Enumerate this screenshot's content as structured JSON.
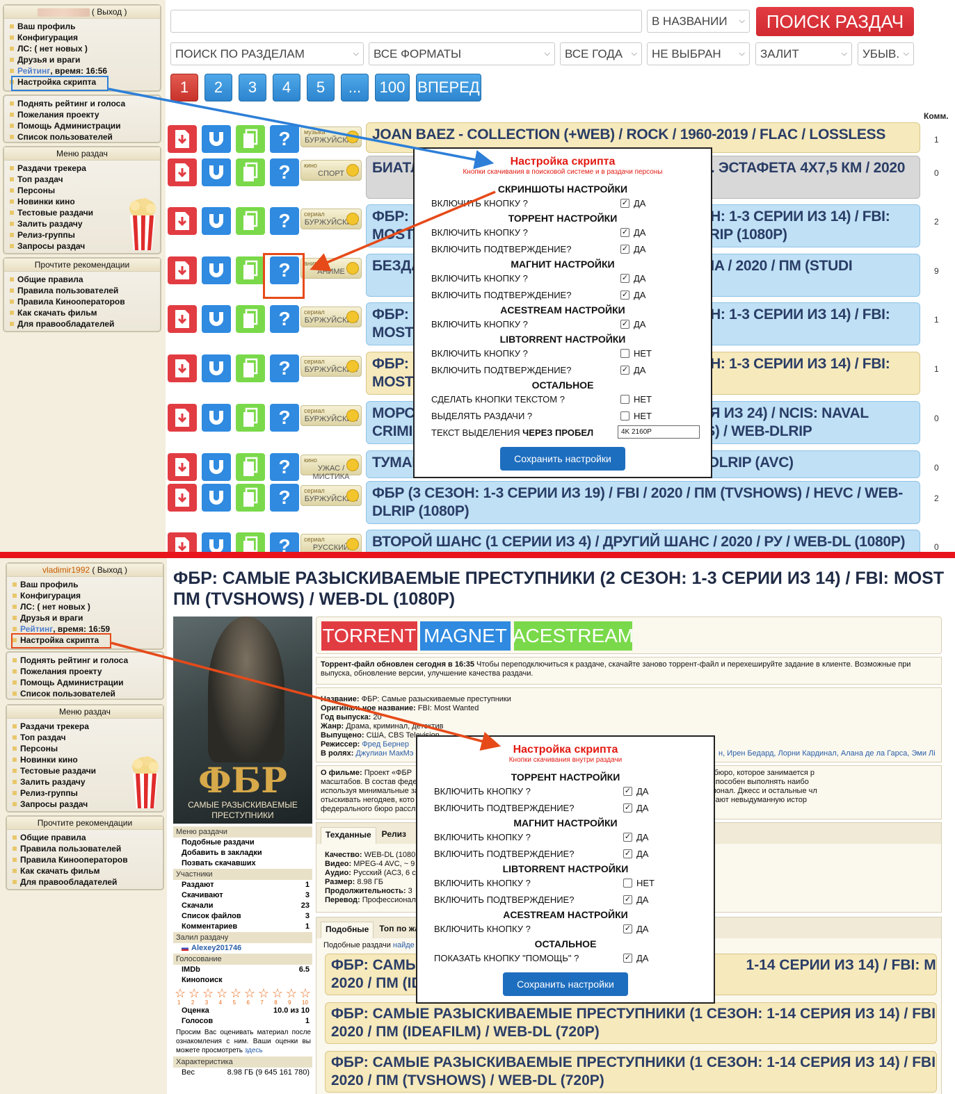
{
  "top": {
    "sidebar_user": {
      "logout": "( Выход )",
      "items": [
        "Ваш профиль",
        "Конфигурация",
        "ЛС: ( нет новых )",
        "Друзья и враги"
      ],
      "rating_link": "Рейтинг",
      "rating_time": ", время: 16:56",
      "script_settings": "Настройка скрипта"
    },
    "sidebar_links": [
      "Поднять рейтинг и голоса",
      "Пожелания проекту",
      "Помощь Администрации",
      "Список пользователей"
    ],
    "menu_header": "Меню раздач",
    "menu_items": [
      "Раздачи трекера",
      "Топ раздач",
      "Персоны",
      "Новинки кино",
      "Тестовые раздачи",
      "Залить раздачу",
      "Релиз-группы",
      "Запросы раздач"
    ],
    "rec_header": "Прочтите рекомендации",
    "rec_items": [
      "Общие правила",
      "Правила пользователей",
      "Правила Кинооператоров",
      "Как скачать фильм",
      "Для правообладателей"
    ],
    "search": {
      "value": "",
      "placeholder": "",
      "scope": "В НАЗВАНИИ",
      "button": "ПОИСК РАЗДАЧ"
    },
    "filters": [
      "ПОИСК ПО РАЗДЕЛАМ",
      "ВСЕ ФОРМАТЫ",
      "ВСЕ ГОДА",
      "НЕ ВЫБРАН",
      "ЗАЛИТ",
      "УБЫВ."
    ],
    "pages": [
      "1",
      "2",
      "3",
      "4",
      "5",
      "...",
      "100",
      "ВПЕРЕД"
    ],
    "comm_header": "Комм.",
    "rows": [
      {
        "cat1": "музыка",
        "cat2": "БУРЖУЙСКАЯ",
        "title": "JOAN BAEZ - COLLECTION (+WEB) / ROCK / 1960-2019 / FLAC / LOSSLESS",
        "color": "y",
        "comm": "1"
      },
      {
        "cat1": "кино",
        "cat2": "СПОРТ",
        "title": "БИАТЛ                                                                     НЫ. ЭСТАФЕТА 4Х7,5 КМ / 2020",
        "color": "g",
        "comm": "0"
      },
      {
        "cat1": "сериал",
        "cat2": "БУРЖУЙСКИЙ",
        "title": "ФБР: С                                                                   ЕЗОН: 1-3 СЕРИИ ИЗ 14) / FBI: MOST                                                                    B-DLRIP (1080P)",
        "color": "b",
        "comm": "2"
      },
      {
        "cat1": "аниме",
        "cat2": "АНИМЕ",
        "title": "БЕЗДА                                                                    NANA / 2020 / ПМ (STUDI",
        "color": "b",
        "comm": "9"
      },
      {
        "cat1": "сериал",
        "cat2": "БУРЖУЙСКИЙ",
        "title": "ФБР: С                                                                   ЕЗОН: 1-3 СЕРИИ ИЗ 14) / FBI: MOST                                                                    0P)",
        "color": "b",
        "comm": "1"
      },
      {
        "cat1": "сериал",
        "cat2": "БУРЖУЙСКИЙ",
        "title": "ФБР: С                                                                   ЕЗОН: 1-3 СЕРИИ ИЗ 14) / FBI: MOST                                                                    80P)",
        "color": "y",
        "comm": "1"
      },
      {
        "cat1": "сериал",
        "cat2": "БУРЖУЙСКИЙ",
        "title": "МОРС                                                                     ЕРИЯ ИЗ 24) / NCIS: NAVAL CRIMIN                                                                   OWS) / WEB-DLRIP",
        "color": "b",
        "comm": "0"
      },
      {
        "cat1": "кино",
        "cat2": "УЖАС / МИСТИКА",
        "title": "ТУМАН                                                                    EB-DLRIP (AVC)",
        "color": "b",
        "comm": "0"
      },
      {
        "cat1": "сериал",
        "cat2": "БУРЖУЙСКИЙ",
        "title": "ФБР (3 СЕЗОН: 1-3 СЕРИИ ИЗ 19) / FBI / 2020 / ПМ (TVSHOWS) / HEVC / WEB-DLRIP (1080P)",
        "color": "b",
        "comm": "2"
      },
      {
        "cat1": "сериал",
        "cat2": "РУССКИЙ",
        "title": "ВТОРОЙ ШАНС (1 СЕРИИ ИЗ 4) / ДРУГИЙ ШАНС / 2020 / РУ / WEB-DL (1080P)",
        "color": "b",
        "comm": "0"
      }
    ],
    "modal": {
      "title": "Настройка скрипта",
      "subtitle": "Кнопки скачивания в поисковой системе и в раздачи персоны",
      "sections": [
        {
          "h": "СКРИНШОТЫ НАСТРОЙКИ",
          "opts": [
            {
              "l": "ВКЛЮЧИТЬ КНОПКУ ?",
              "v": "ДА",
              "c": true
            }
          ]
        },
        {
          "h": "ТОРРЕНТ НАСТРОЙКИ",
          "opts": [
            {
              "l": "ВКЛЮЧИТЬ КНОПКУ ?",
              "v": "ДА",
              "c": true
            },
            {
              "l": "ВКЛЮЧИТЬ ПОДТВЕРЖДЕНИЕ?",
              "v": "ДА",
              "c": true
            }
          ]
        },
        {
          "h": "МАГНИТ НАСТРОЙКИ",
          "opts": [
            {
              "l": "ВКЛЮЧИТЬ КНОПКУ ?",
              "v": "ДА",
              "c": true
            },
            {
              "l": "ВКЛЮЧИТЬ ПОДТВЕРЖДЕНИЕ?",
              "v": "ДА",
              "c": true
            }
          ]
        },
        {
          "h": "ACESTREAM НАСТРОЙКИ",
          "opts": [
            {
              "l": "ВКЛЮЧИТЬ КНОПКУ ?",
              "v": "ДА",
              "c": true
            }
          ]
        },
        {
          "h": "LIBTORRENT НАСТРОЙКИ",
          "opts": [
            {
              "l": "ВКЛЮЧИТЬ КНОПКУ ?",
              "v": "НЕТ",
              "c": false
            },
            {
              "l": "ВКЛЮЧИТЬ ПОДТВЕРЖДЕНИЕ?",
              "v": "ДА",
              "c": true
            }
          ]
        },
        {
          "h": "ОСТАЛЬНОЕ",
          "opts": [
            {
              "l": "СДЕЛАТЬ КНОПКИ ТЕКСТОМ ?",
              "v": "НЕТ",
              "c": false
            },
            {
              "l": "ВЫДЕЛЯТЬ РАЗДАЧИ ?",
              "v": "НЕТ",
              "c": false
            }
          ]
        }
      ],
      "text_label_a": "ТЕКСТ ВЫДЕЛЕНИЯ ",
      "text_label_b": "ЧЕРЕЗ ПРОБЕЛ",
      "text_value": "4K 2160P",
      "save": "Сохранить настройки"
    }
  },
  "bottom": {
    "user": "vladimir1992",
    "logout": "( Выход )",
    "items": [
      "Ваш профиль",
      "Конфигурация",
      "ЛС: ( нет новых )",
      "Друзья и враги"
    ],
    "rating_link": "Рейтинг",
    "rating_time": ", время: 16:59",
    "script_settings": "Настройка скрипта",
    "page_title_1": "ФБР: САМЫЕ РАЗЫСКИВАЕМЫЕ ПРЕСТУПНИКИ (2 СЕЗОН: 1-3 СЕРИИ ИЗ 14) / FBI: MOST",
    "page_title_2": "ПМ (TVSHOWS) / WEB-DL (1080P)",
    "poster_title": "ФБР",
    "poster_sub1": "САМЫЕ РАЗЫСКИВАЕМЫЕ",
    "poster_sub2": "ПРЕСТУПНИКИ",
    "buttons": [
      "TORRENT",
      "MAGNET",
      "ACESTREAM"
    ],
    "update_bold": "Торрент-файл обновлен сегодня в 16:35",
    "update_text": " Чтобы переподключиться к раздаче, скачайте заново торрент-файл и перехешируйте задание в клиенте. Возможные при",
    "update_text2": "выпуска, обновление версии, улучшение качества раздачи.",
    "info": [
      {
        "k": "Название:",
        "v": " ФБР: Самые разыскиваемые преступники"
      },
      {
        "k": "Оригинальное название:",
        "v": " FBI: Most Wanted"
      },
      {
        "k": "Год выпуска:",
        "v": " 20"
      },
      {
        "k": "Жанр:",
        "v": " Драма, криминал, детектив"
      },
      {
        "k": "Выпущено:",
        "v": " США, CBS Television"
      },
      {
        "k": "Режиссер:",
        "v": " Фред Бернер"
      },
      {
        "k": "В ролях:",
        "v": " Джулиан МакМэ"
      }
    ],
    "cast_tail": "н, Ирен Бедард, Лорни Кардинал, Алана де ла Гарса, Эми Лі",
    "about_bold": "О фильме:",
    "about": [
      " Проект «ФБР                                                                                     одного из самых востребованных бюро, которое занимается р",
      "масштабов. В состав феде                                                                                    Лакруа — один из немногих, кто способен выполнять наибо",
      "используя минимальные за                                                                                   твовать, как настоящий профессионал. Джесс и остальные чл",
      "отыскивать негодяев, кото                                                                                   сценария этого сериала рассказывают невыдуманную истор",
      "федерального бюро рассле"
    ],
    "tech_tabs": [
      "Техданные",
      "Релиз",
      "В"
    ],
    "tech": [
      {
        "k": "Качество:",
        "v": " WEB-DL (1080"
      },
      {
        "k": "Видео:",
        "v": " MPEG-4 AVC, ~ 9"
      },
      {
        "k": "Аудио:",
        "v": " Русский (AC3, 6 с"
      },
      {
        "k": "Размер:",
        "v": " 8.98 ГБ"
      },
      {
        "k": "Продолжительность:",
        "v": " 3"
      },
      {
        "k": "Перевод:",
        "v": " Профессионал"
      }
    ],
    "sim_tabs": [
      "Подобные",
      "Топ по жан"
    ],
    "sim_caption": "Подобные раздачи ",
    "sim_link": "найде",
    "similar": [
      "ФБР: САМЫЕ                                                                              1-14 СЕРИИ ИЗ 14) / FBI: MOST WA",
      "2020 / ПМ (ID",
      "ФБР: САМЫЕ РАЗЫСКИВАЕМЫЕ ПРЕСТУПНИКИ (1 СЕЗОН: 1-14 СЕРИЯ ИЗ 14) / FBI: MOST WA",
      "2020 / ПМ (IDEAFILM) / WEB-DL (720P)",
      "ФБР: САМЫЕ РАЗЫСКИВАЕМЫЕ ПРЕСТУПНИКИ (1 СЕЗОН: 1-14 СЕРИЯ ИЗ 14) / FBI: MOST WA",
      "2020 / ПМ (TVSHOWS) / WEB-DL (720P)"
    ],
    "left_menu_header": "Меню раздачи",
    "left_menu": [
      "Подобные раздачи",
      "Добавить в закладки",
      "Позвать скачавших"
    ],
    "participants_header": "Участники",
    "participants": [
      {
        "k": "Раздают",
        "v": "1"
      },
      {
        "k": "Скачивают",
        "v": "3"
      },
      {
        "k": "Скачали",
        "v": "23"
      },
      {
        "k": "Список файлов",
        "v": "3"
      },
      {
        "k": "Комментариев",
        "v": "1"
      }
    ],
    "uploader_header": "Залил раздачу",
    "uploader": "Alexey201746",
    "vote_header": "Голосование",
    "votes": [
      {
        "k": "IMDb",
        "v": "6.5"
      },
      {
        "k": "Кинопоиск",
        "v": ""
      }
    ],
    "star_nums": [
      "1",
      "2",
      "3",
      "4",
      "5",
      "6",
      "7",
      "8",
      "9",
      "10"
    ],
    "score": [
      {
        "k": "Оценка",
        "v": "10.0 из 10"
      },
      {
        "k": "Голосов",
        "v": "1"
      }
    ],
    "vote_note": "Просим Вас оценивать материал после ознакомления с ним. Ваши оценки вы можете просмотреть ",
    "vote_link": "здесь",
    "char_header": "Характеристика",
    "char_row": {
      "k": "Вес",
      "v": "8.98 ГБ (9 645 161 780)"
    },
    "modal": {
      "title": "Настройка скрипта",
      "subtitle": "Кнопки скачивания внутри раздачи",
      "sections": [
        {
          "h": "ТОРРЕНТ НАСТРОЙКИ",
          "opts": [
            {
              "l": "ВКЛЮЧИТЬ КНОПКУ ?",
              "v": "ДА",
              "c": true
            },
            {
              "l": "ВКЛЮЧИТЬ ПОДТВЕРЖДЕНИЕ?",
              "v": "ДА",
              "c": true
            }
          ]
        },
        {
          "h": "МАГНИТ НАСТРОЙКИ",
          "opts": [
            {
              "l": "ВКЛЮЧИТЬ КНОПКУ ?",
              "v": "ДА",
              "c": true
            },
            {
              "l": "ВКЛЮЧИТЬ ПОДТВЕРЖДЕНИЕ?",
              "v": "ДА",
              "c": true
            }
          ]
        },
        {
          "h": "LIBTORRENT НАСТРОЙКИ",
          "opts": [
            {
              "l": "ВКЛЮЧИТЬ КНОПКУ ?",
              "v": "НЕТ",
              "c": false
            },
            {
              "l": "ВКЛЮЧИТЬ ПОДТВЕРЖДЕНИЕ?",
              "v": "ДА",
              "c": true
            }
          ]
        },
        {
          "h": "ACESTREAM НАСТРОЙКИ",
          "opts": [
            {
              "l": "ВКЛЮЧИТЬ КНОПКУ ?",
              "v": "ДА",
              "c": true
            }
          ]
        },
        {
          "h": "ОСТАЛЬНОЕ",
          "opts": [
            {
              "l": "ПОКАЗАТЬ КНОПКУ \"ПОМОЩЬ\" ?",
              "v": "ДА",
              "c": true
            }
          ]
        }
      ],
      "save": "Сохранить настройки"
    }
  },
  "colors": {
    "accent_red": "#e23c43",
    "accent_blue": "#2f8ae0",
    "accent_green": "#7ad94a",
    "divider": "#e8131b",
    "arrow_blue": "#2d7fd8",
    "arrow_red": "#e64a19"
  }
}
